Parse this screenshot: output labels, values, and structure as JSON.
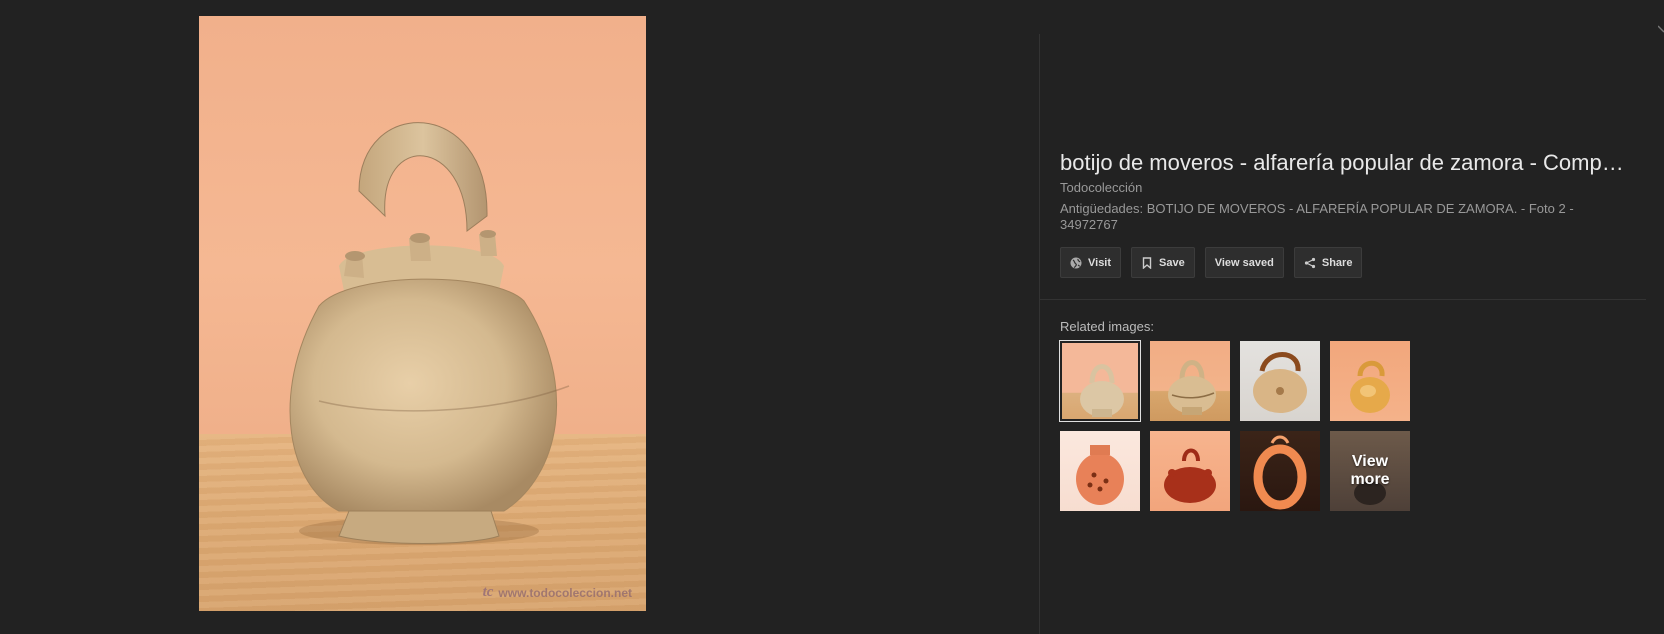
{
  "main_image": {
    "watermark_text": "www.todocoleccion.net",
    "watermark_logo": "tc"
  },
  "details": {
    "title": "botijo de moveros - alfarería popular de zamora - Comp…",
    "source": "Todocolección",
    "description": "Antigüedades: BOTIJO DE MOVEROS - ALFARERÍA POPULAR DE ZAMORA. - Foto 2 - 34972767"
  },
  "actions": {
    "visit": {
      "label": "Visit",
      "icon": "globe-icon"
    },
    "save": {
      "label": "Save",
      "icon": "bookmark-icon"
    },
    "view_saved": {
      "label": "View saved"
    },
    "share": {
      "label": "Share",
      "icon": "share-icon"
    }
  },
  "related": {
    "label": "Related images:",
    "view_more_label": "View\nmore",
    "thumbnails": [
      {
        "name": "related-thumb-botijo-clay",
        "selected": true
      },
      {
        "name": "related-thumb-botijo-decorated",
        "selected": false
      },
      {
        "name": "related-thumb-botijo-brown-handle",
        "selected": false
      },
      {
        "name": "related-thumb-botijo-yellow",
        "selected": false
      },
      {
        "name": "related-thumb-jug-orange-holes",
        "selected": false
      },
      {
        "name": "related-thumb-botijo-red",
        "selected": false
      },
      {
        "name": "related-thumb-ring-botijo",
        "selected": false
      },
      {
        "name": "related-thumb-view-more",
        "selected": false
      }
    ]
  }
}
